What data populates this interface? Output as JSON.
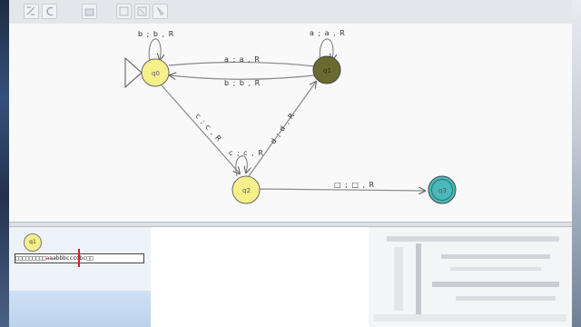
{
  "toolbar": {
    "tools": [
      {
        "name": "attribute-editor-icon"
      },
      {
        "name": "undo-icon"
      },
      {
        "name": "state-creator-icon"
      },
      {
        "name": "transition-creator-icon"
      },
      {
        "name": "deleter-icon"
      },
      {
        "name": "select-icon"
      }
    ]
  },
  "automaton": {
    "states": [
      {
        "id": "q0",
        "label": "q0",
        "initial": true,
        "final": false,
        "color": "#f7f08a"
      },
      {
        "id": "q1",
        "label": "q1",
        "initial": false,
        "final": false,
        "color": "#6a6a30"
      },
      {
        "id": "q2",
        "label": "q2",
        "initial": false,
        "final": false,
        "color": "#f7f08a"
      },
      {
        "id": "q3",
        "label": "q3",
        "initial": false,
        "final": true,
        "color": "#49b9b9"
      }
    ],
    "transitions": [
      {
        "from": "q0",
        "to": "q0",
        "label": "b ; b , R"
      },
      {
        "from": "q1",
        "to": "q1",
        "label": "a ; a , R"
      },
      {
        "from": "q0",
        "to": "q1",
        "label": "a ; a , R"
      },
      {
        "from": "q1",
        "to": "q0",
        "label": "b ; b , R"
      },
      {
        "from": "q0",
        "to": "q2",
        "label": "c ; c , R"
      },
      {
        "from": "q2",
        "to": "q2",
        "label": "c ; c , R"
      },
      {
        "from": "q2",
        "to": "q1",
        "label": "d ; d , R"
      },
      {
        "from": "q2",
        "to": "q3",
        "label": "□ ; □ , R"
      }
    ]
  },
  "simulation": {
    "current_state": "q1",
    "tape_left": "□□□□□□□□□",
    "tape_head": "a",
    "tape_right": "aabbbcccdbc□□",
    "accent_color": "#d22222"
  }
}
